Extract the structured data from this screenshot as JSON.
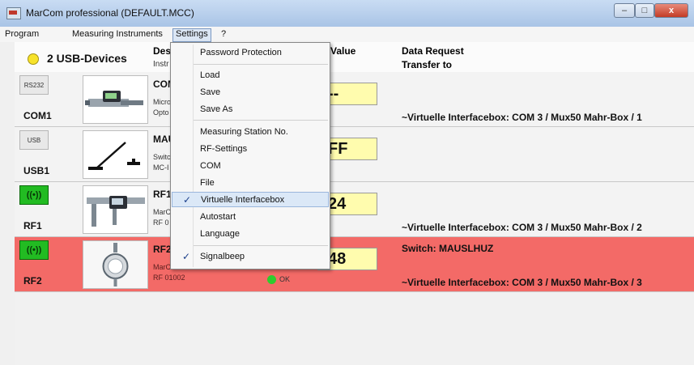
{
  "window": {
    "title": "MarCom professional  (DEFAULT.MCC)",
    "min": "–",
    "max": "□",
    "close": "x"
  },
  "menubar": {
    "program": "Program",
    "measuring": "Measuring Instruments",
    "settings": "Settings",
    "help": "?"
  },
  "header": {
    "devices": "2 USB-Devices",
    "des": "Des",
    "instr": "Instr",
    "value": "Value",
    "data_request": "Data Request",
    "transfer_to": "Transfer to"
  },
  "rows": [
    {
      "icon": "RS232",
      "port": "COM1",
      "name": "COM",
      "sub1": "Micro",
      "sub2": "Opto",
      "value": "--",
      "transfer": "~Virtuelle Interfacebox: COM 3 / Mux50 Mahr-Box / 1",
      "photo": "micrometer"
    },
    {
      "icon": "USB",
      "port": "USB1",
      "name": "MAU",
      "sub1": "Switc",
      "sub2": "MC-I",
      "value": "FF",
      "transfer": "",
      "photo": "foot-switch"
    },
    {
      "icon": "((•))",
      "port": "RF1",
      "name": "RF1",
      "sub1": "MarC",
      "sub2": "RF 0",
      "value": "24",
      "transfer": "~Virtuelle Interfacebox: COM 3 / Mux50 Mahr-Box / 2",
      "photo": "caliper"
    },
    {
      "icon": "((•))",
      "port": "RF2",
      "name": "RF2",
      "sub1": "MarCator 1087Ri",
      "sub2": "RF 01002",
      "value": "48",
      "switch": "Switch: MAUSLHUZ",
      "ok": "OK",
      "transfer": "~Virtuelle Interfacebox: COM 3 / Mux50 Mahr-Box / 3",
      "photo": "dial-indicator"
    }
  ],
  "settings_menu": {
    "items": [
      "Password Protection",
      "Load",
      "Save",
      "Save As",
      "Measuring Station No.",
      "RF-Settings",
      "COM",
      "File",
      "Virtuelle Interfacebox",
      "Autostart",
      "Language",
      "Signalbeep"
    ],
    "checked": [
      "Virtuelle Interfacebox",
      "Signalbeep"
    ],
    "highlighted": "Virtuelle Interfacebox",
    "check_glyph": "✓"
  },
  "colors": {
    "error_row": "#f36a67",
    "value_box": "#fffcae",
    "usb_dot": "#f7e22a",
    "rf_green": "#22bb22"
  }
}
